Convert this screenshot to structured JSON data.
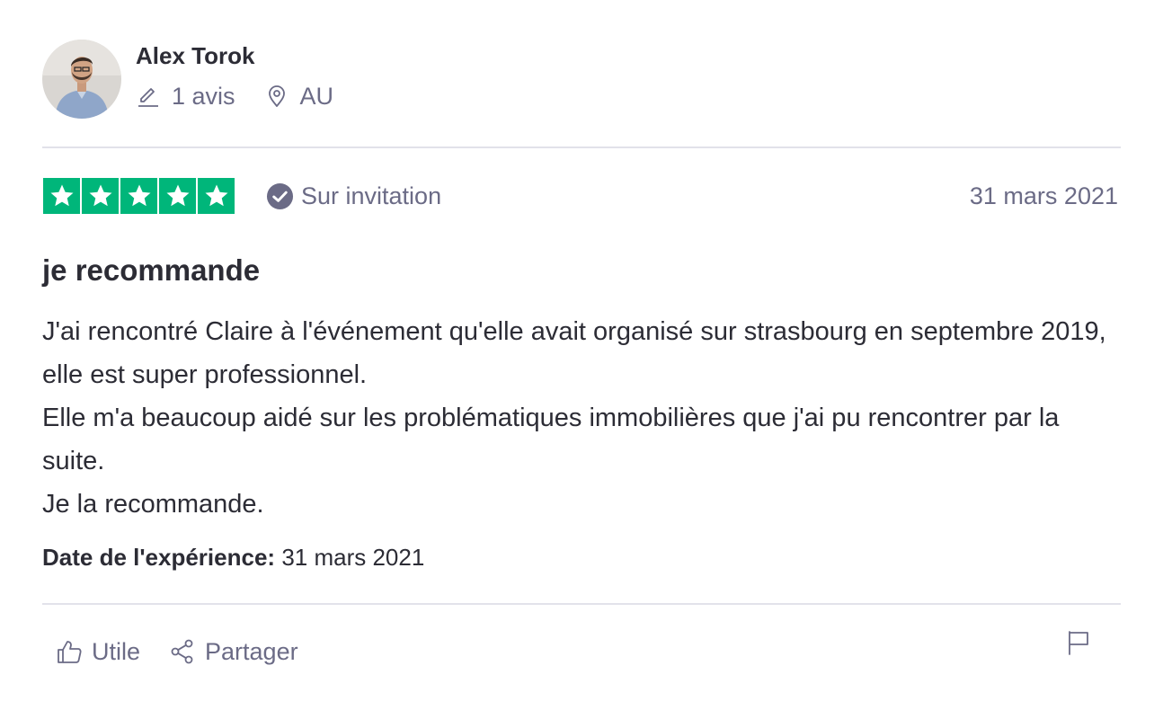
{
  "consumer": {
    "name": "Alex Torok",
    "reviews_count": "1 avis",
    "country": "AU"
  },
  "review": {
    "rating": 5,
    "rating_max": 5,
    "star_color": "#00b67a",
    "verification": "Sur invitation",
    "date": "31 mars 2021",
    "title": "je recommande",
    "body": [
      "J'ai rencontré Claire à l'événement qu'elle avait organisé sur strasbourg en septembre 2019, elle est super professionnel.",
      "Elle m'a beaucoup aidé sur les problématiques immobilières que j'ai pu rencontrer par la suite.",
      "Je la recommande."
    ],
    "experience_label": "Date de l'expérience:",
    "experience_date": "31 mars 2021"
  },
  "actions": {
    "useful_label": "Utile",
    "share_label": "Partager"
  },
  "icons": {
    "reviews": "pencil-icon",
    "country": "location-pin-icon",
    "verified": "check-circle-icon",
    "useful": "thumbs-up-icon",
    "share": "share-icon",
    "report": "flag-icon"
  },
  "colors": {
    "muted_text": "#6b6b86",
    "primary_text": "#2c2c35",
    "divider": "#e2e2ea"
  }
}
